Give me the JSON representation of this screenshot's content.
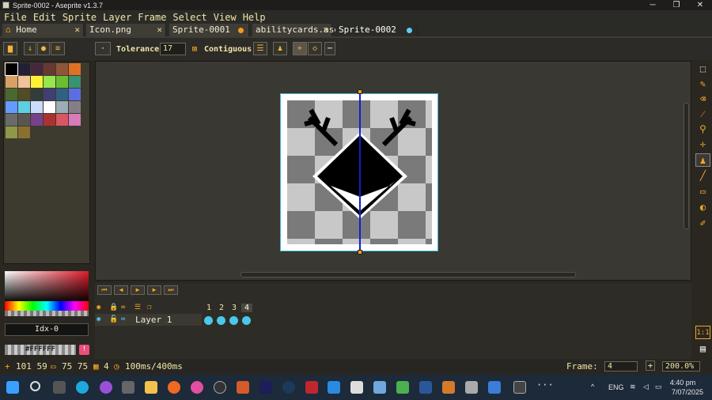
{
  "window": {
    "title": "Sprite-0002 - Aseprite v1.3.7",
    "controls": [
      "─",
      "❐",
      "✕"
    ]
  },
  "menu": [
    "File",
    "Edit",
    "Sprite",
    "Layer",
    "Frame",
    "Select",
    "View",
    "Help"
  ],
  "tabs": [
    {
      "label": "Home",
      "close": "✕"
    },
    {
      "label": "Icon.png",
      "close": "✕"
    },
    {
      "label": "Sprite-0001",
      "modified": true
    },
    {
      "label": "abilitycards.ase",
      "close": "✕"
    },
    {
      "label": "Sprite-0002",
      "modified": true,
      "active": true
    }
  ],
  "context": {
    "tolerance_label": "Tolerance:",
    "tolerance_value": "17",
    "contiguous_label": "Contiguous",
    "pixel_button": "·"
  },
  "palette": {
    "colors": [
      "#000000",
      "#222034",
      "#45283c",
      "#663931",
      "#8f563b",
      "#df7126",
      "#d9a066",
      "#eec39a",
      "#fbf236",
      "#99e550",
      "#6abe30",
      "#37946e",
      "#4b692f",
      "#524b24",
      "#323c39",
      "#3f3f74",
      "#306082",
      "#5b6ee1",
      "#639bff",
      "#5fcde4",
      "#cbdbfc",
      "#ffffff",
      "#9badb7",
      "#847e87",
      "#696a6a",
      "#595652",
      "#76428a",
      "#ac3232",
      "#d95763",
      "#d77bba",
      "#8f974a",
      "#8a6f30"
    ]
  },
  "color": {
    "index_label": "Idx-0",
    "hex": "#FFFFFF",
    "fg": "#000000"
  },
  "timeline": {
    "layer_name": "Layer 1",
    "frames": [
      "1",
      "2",
      "3",
      "4"
    ],
    "active_frame": "4"
  },
  "status": {
    "cursor": "101 59",
    "size": "75 75",
    "frames": "4",
    "duration": "100ms/400ms",
    "frame_label": "Frame:",
    "frame_value": "4",
    "zoom": "200.0%"
  },
  "taskbar": {
    "lang": "ENG",
    "time": "4:40 pm",
    "date": "7/07/2025"
  }
}
